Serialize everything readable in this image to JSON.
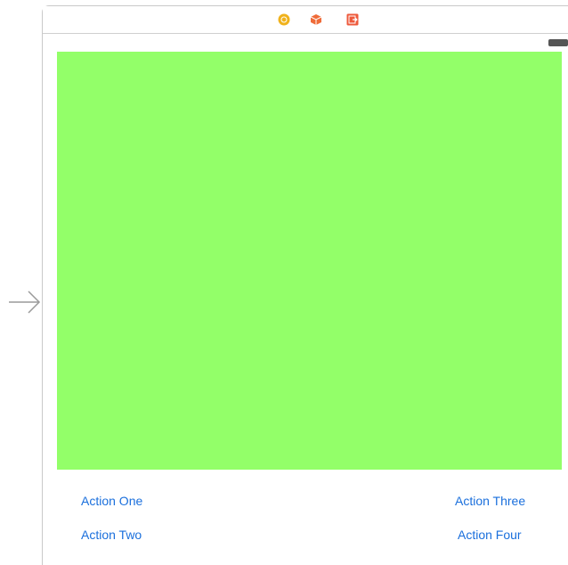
{
  "storyboard": {
    "dock_icons": [
      "view-controller-icon",
      "first-responder-icon",
      "exit-icon"
    ],
    "accent_color": "#1a6fdc",
    "view_background_color": "#93ff69"
  },
  "buttons": {
    "action_one": "Action One",
    "action_two": "Action Two",
    "action_three": "Action Three",
    "action_four": "Action Four"
  }
}
